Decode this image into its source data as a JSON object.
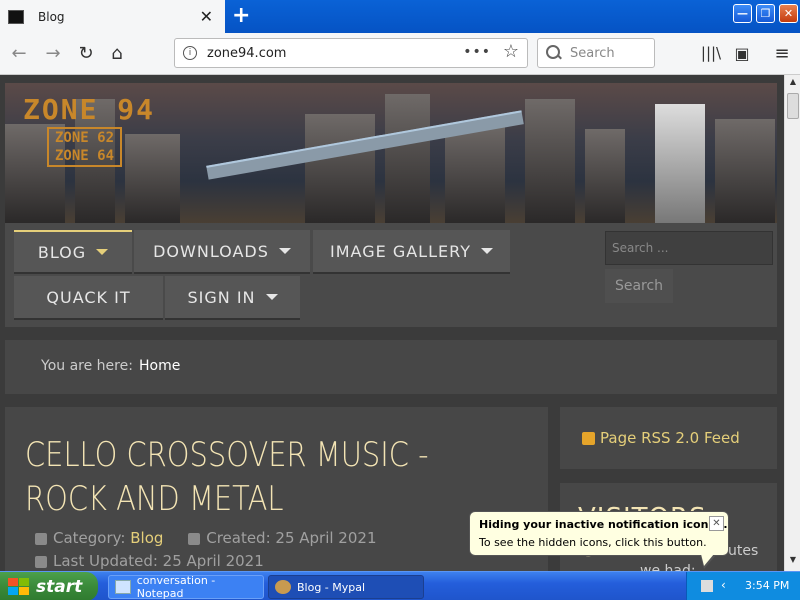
{
  "browser": {
    "tab_title": "Blog",
    "url": "zone94.com",
    "url_actions": "•••",
    "search_placeholder": "Search"
  },
  "site": {
    "logo_main": "ZONE 94",
    "logo_sub_1": "ZONE 62",
    "logo_sub_2": "ZONE 64",
    "nav": [
      {
        "label": "BLOG"
      },
      {
        "label": "DOWNLOADS"
      },
      {
        "label": "IMAGE GALLERY"
      },
      {
        "label": "QUACK IT"
      },
      {
        "label": "SIGN IN"
      }
    ],
    "search_placeholder": "Search ...",
    "search_button": "Search",
    "breadcrumb_label": "You are here:",
    "breadcrumb_home": "Home",
    "article": {
      "title": "CELLO CROSSOVER MUSIC - ROCK AND METAL",
      "category_label": "Category:",
      "category_value": "Blog",
      "created": "Created: 25 April 2021",
      "updated": "Last Updated: 25 April 2021"
    },
    "rss_label": "Page RSS 2.0 Feed",
    "visitors_title": "VISITORS ONLINE",
    "visitors_text1": "utes",
    "visitors_text2": "we had:"
  },
  "balloon": {
    "title": "Hiding your inactive notification icons...",
    "text": "To see the hidden icons, click this button.",
    "close": "✕"
  },
  "taskbar": {
    "start_label": "start",
    "tasks": [
      {
        "label": "conversation - Notepad"
      },
      {
        "label": "Blog - Mypal"
      }
    ],
    "time": "3:54 PM"
  }
}
